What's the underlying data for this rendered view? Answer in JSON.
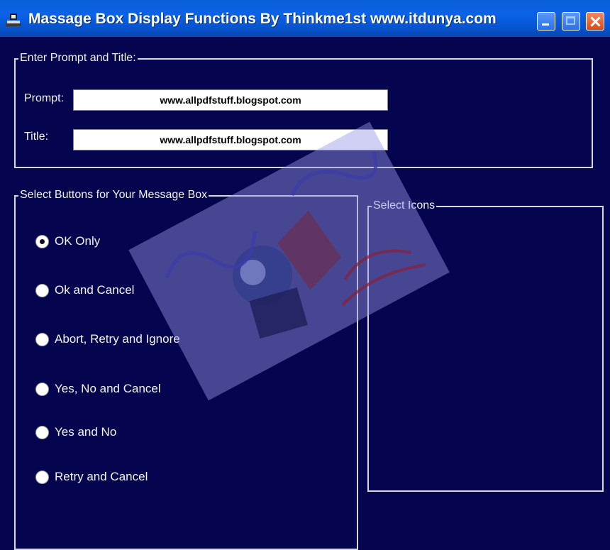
{
  "window": {
    "title": "Massage Box Display Functions  By Thinkme1st www.itdunya.com"
  },
  "prompt_group": {
    "legend": "Enter Prompt and Title:",
    "prompt_label": "Prompt:",
    "prompt_value": "www.allpdfstuff.blogspot.com",
    "title_label": "Title:",
    "title_value": "www.allpdfstuff.blogspot.com"
  },
  "buttons_group": {
    "legend": "Select Buttons for Your Message Box",
    "options": [
      {
        "label": "OK Only",
        "checked": true
      },
      {
        "label": "Ok and Cancel",
        "checked": false
      },
      {
        "label": "Abort, Retry and Ignore",
        "checked": false
      },
      {
        "label": "Yes, No and Cancel",
        "checked": false
      },
      {
        "label": "Yes and No",
        "checked": false
      },
      {
        "label": "Retry and Cancel",
        "checked": false
      }
    ]
  },
  "icons_group": {
    "legend": "Select Icons"
  },
  "colors": {
    "background": "#04044f",
    "titlebar": "#0b62e6",
    "close_button": "#d9481b"
  }
}
